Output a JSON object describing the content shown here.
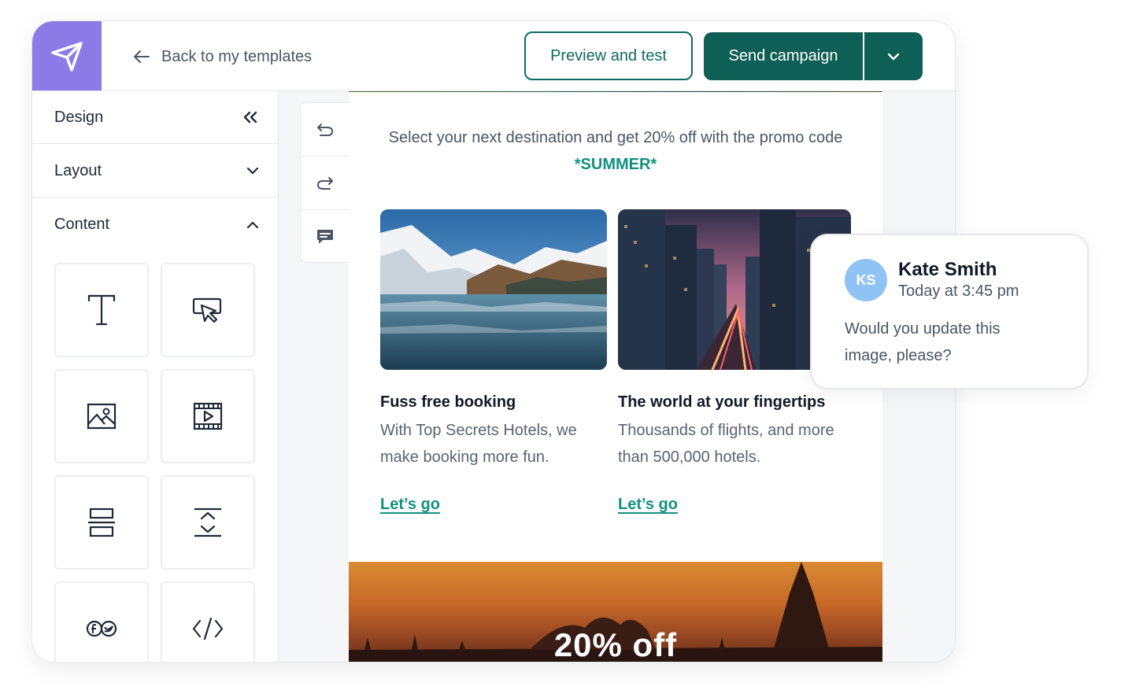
{
  "header": {
    "back_label": "Back to my templates",
    "preview_label": "Preview and test",
    "send_label": "Send campaign"
  },
  "sidebar": {
    "sections": [
      {
        "label": "Design",
        "icon": "double-chevron-left-icon"
      },
      {
        "label": "Layout",
        "icon": "chevron-down-icon"
      },
      {
        "label": "Content",
        "icon": "chevron-up-icon"
      }
    ],
    "blocks": [
      "text-block-icon",
      "button-block-icon",
      "image-block-icon",
      "video-block-icon",
      "divider-block-icon",
      "spacer-block-icon",
      "social-block-icon",
      "html-block-icon"
    ]
  },
  "tools": [
    "undo-icon",
    "redo-icon",
    "comment-icon"
  ],
  "email": {
    "promo_text": "Select your next destination and get 20% off with the promo code",
    "promo_code": "*SUMMER*",
    "cards": [
      {
        "title": "Fuss free booking",
        "description": "With Top Secrets Hotels, we make booking more fun.",
        "link": "Let’s go"
      },
      {
        "title": "The world at your fingertips",
        "description": "Thousands of flights, and more than 500,000 hotels.",
        "link": "Let’s go"
      }
    ],
    "banner_text": "20% off"
  },
  "comment": {
    "initials": "KS",
    "name": "Kate Smith",
    "time": "Today at 3:45 pm",
    "body": "Would you update this image, please?"
  },
  "colors": {
    "brand_purple": "#8c7ae6",
    "primary_teal": "#0e5f55",
    "link_teal": "#12907e",
    "avatar_blue": "#8ec3f4"
  }
}
